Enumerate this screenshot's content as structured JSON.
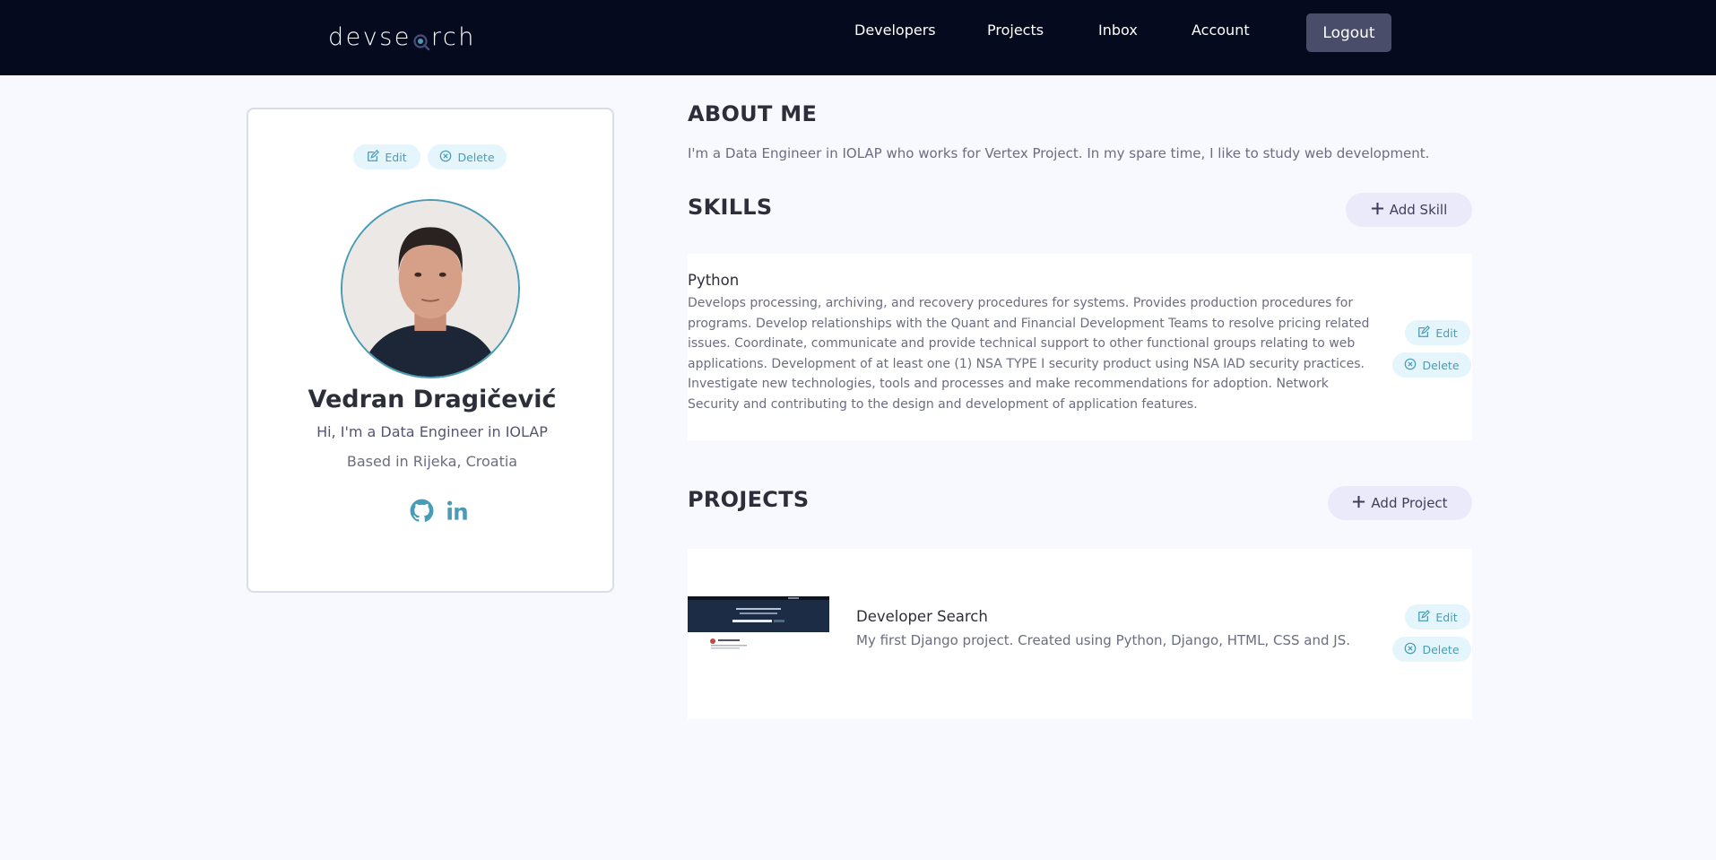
{
  "brand": {
    "logo_before": "devse",
    "logo_after": "rch"
  },
  "nav": {
    "items": [
      {
        "label": "Developers"
      },
      {
        "label": "Projects"
      },
      {
        "label": "Inbox"
      },
      {
        "label": "Account"
      }
    ],
    "logout_label": "Logout"
  },
  "profile": {
    "edit_label": "Edit",
    "delete_label": "Delete",
    "name": "Vedran Dragičević",
    "short_intro": "Hi, I'm a Data Engineer in IOLAP",
    "location": "Based in Rijeka, Croatia",
    "social_icons": [
      "github-icon",
      "linkedin-icon"
    ]
  },
  "about": {
    "title": "ABOUT ME",
    "text": "I'm a Data Engineer in IOLAP who works for Vertex Project. In my spare time, I like to study web development."
  },
  "skills": {
    "title": "SKILLS",
    "add_label": "Add Skill",
    "items": [
      {
        "name": "Python",
        "description": "Develops processing, archiving, and recovery procedures for systems. Provides production procedures for programs. Develop relationships with the Quant and Financial Development Teams to resolve pricing related issues. Coordinate, communicate and provide technical support to other functional groups relating to web applications. Development of at least one (1) NSA TYPE I security product using NSA IAD security practices. Investigate new technologies, tools and processes and make recommendations for adoption. Network Security and contributing to the design and development of application features.",
        "edit_label": "Edit",
        "delete_label": "Delete"
      }
    ]
  },
  "projects": {
    "title": "PROJECTS",
    "add_label": "Add Project",
    "items": [
      {
        "title": "Developer Search",
        "description": "My first Django project. Created using Python, Django, HTML, CSS and JS.",
        "edit_label": "Edit",
        "delete_label": "Delete"
      }
    ]
  },
  "colors": {
    "navbar": "#050a1f",
    "accent": "#4a9bb5",
    "pill_bg": "#e5f5fc",
    "add_btn_bg": "#ebeafb",
    "page_bg": "#f8f9fe"
  }
}
